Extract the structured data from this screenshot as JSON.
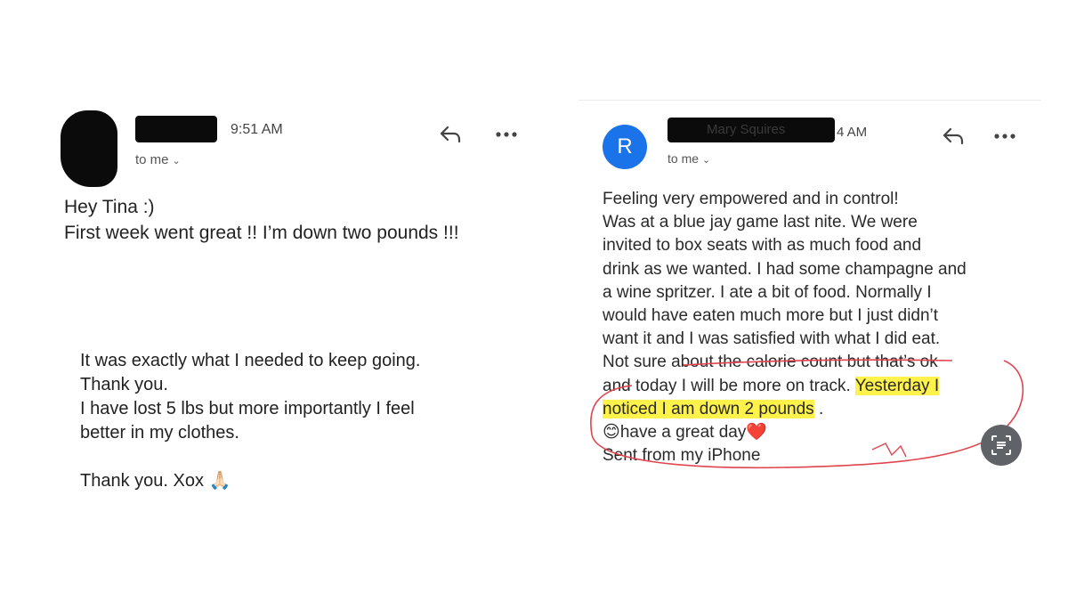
{
  "left_email": {
    "time": "9:51 AM",
    "to_label": "to me",
    "lines_top": [
      "Hey Tina :)",
      "First week went great !! I’m down two pounds !!!"
    ],
    "lines_bottom": [
      "It was exactly what I needed to keep going.",
      "Thank you.",
      "I have lost 5 lbs but more importantly I feel",
      "better in my clothes.",
      "",
      "Thank you. Xox 🙏🏻"
    ],
    "icons": [
      "reply-icon",
      "more-icon"
    ]
  },
  "right_email": {
    "avatar_letter": "R",
    "sender_partial": "Mary Squires",
    "time_partial": "4 AM",
    "to_label": "to me",
    "lines": [
      "Feeling very empowered and in control!",
      "Was at a blue jay game last nite. We were",
      "invited to box seats with as much food and",
      "drink as we wanted. I had some champagne and",
      "a wine spritzer. I ate a bit of food. Normally I",
      "would have eaten much more but I just didn’t",
      "want it and I was satisfied with what I did eat.",
      "Not sure about the calorie count but that’s ok"
    ],
    "line9_plain": "and today I will be more on track.",
    "line9_highlight": "Yesterday I",
    "line10_highlight": "noticed I am down 2 pounds",
    "line10_after": " .",
    "line11_emoji_start": "😊",
    "line11_text": "have a great day",
    "line11_emoji_end": "❤️",
    "line12": "Sent from my iPhone",
    "icons": [
      "reply-icon",
      "more-icon",
      "lens-icon"
    ],
    "colors": {
      "avatar": "#1a73e8",
      "highlight": "#fff24a",
      "annotation": "#e0444f"
    }
  }
}
